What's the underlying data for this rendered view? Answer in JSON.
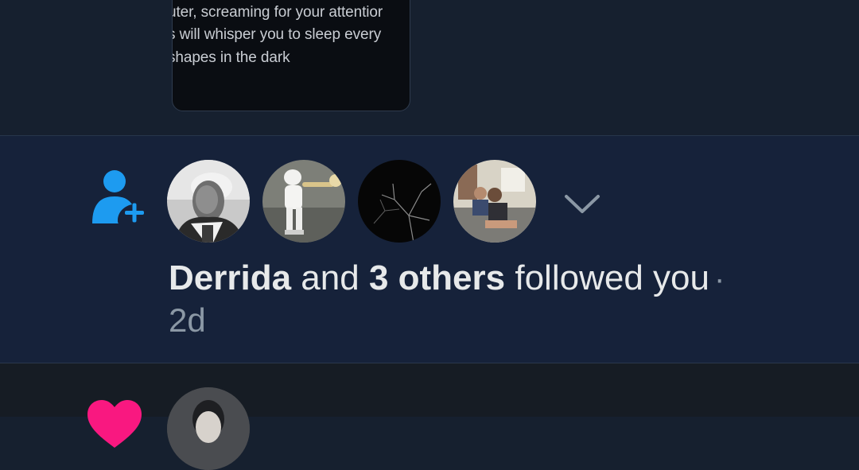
{
  "quote_card": {
    "lines": [
      "uter, screaming for your attentior",
      "s will whisper you to sleep every",
      "shapes in the dark"
    ]
  },
  "follow_notification": {
    "icon": "person-add-icon",
    "actor_name": "Derrida",
    "connector": " and ",
    "others": "3 others",
    "action": " followed you",
    "separator": "·",
    "time": "2d",
    "avatars": [
      "avatar-derrida",
      "avatar-robot-trumpet",
      "avatar-dark-branches",
      "avatar-family-couch"
    ],
    "expand_icon": "chevron-down-icon",
    "colors": {
      "icon": "#1d9bf0",
      "text": "#e7e9ea",
      "muted": "#8b98a5",
      "background": "#16223a"
    }
  },
  "like_notification": {
    "icon": "heart-icon",
    "colors": {
      "icon": "#f91880"
    }
  }
}
